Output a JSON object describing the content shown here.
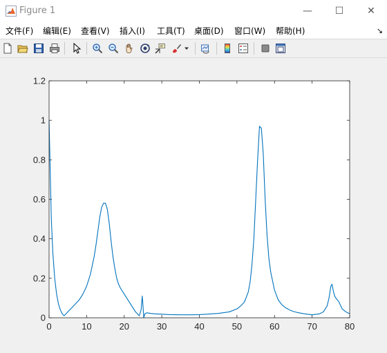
{
  "window": {
    "title": "Figure 1",
    "minimize_glyph": "—",
    "maximize_glyph": "☐",
    "close_glyph": "✕"
  },
  "menu": {
    "items": [
      "文件(F)",
      "编辑(E)",
      "查看(V)",
      "插入(I)",
      "工具(T)",
      "桌面(D)",
      "窗口(W)",
      "帮助(H)"
    ],
    "overflow_arrow": "↘"
  },
  "toolbar": {
    "icons": [
      "new-figure-icon",
      "open-file-icon",
      "save-icon",
      "print-icon",
      "select-arrow-icon",
      "zoom-in-icon",
      "zoom-out-icon",
      "pan-hand-icon",
      "rotate-3d-icon",
      "data-cursor-icon",
      "brush-icon",
      "brush-dropdown-icon",
      "link-plot-icon",
      "colorbar-icon",
      "legend-icon",
      "hide-plot-tools-icon",
      "show-plot-tools-icon"
    ]
  },
  "colors": {
    "line": "#0072bd",
    "axes_bg": "#ffffff",
    "figure_bg": "#f0f0f0"
  },
  "chart_data": {
    "type": "line",
    "xlim": [
      0,
      80
    ],
    "ylim": [
      0,
      1.2
    ],
    "xticks": [
      0,
      10,
      20,
      30,
      40,
      50,
      60,
      70,
      80
    ],
    "yticks": [
      0,
      0.2,
      0.4,
      0.6,
      0.8,
      1,
      1.2
    ],
    "xtick_labels": [
      "0",
      "10",
      "20",
      "30",
      "40",
      "50",
      "60",
      "70",
      "80"
    ],
    "ytick_labels": [
      "0",
      "0.2",
      "0.4",
      "0.6",
      "0.8",
      "1",
      "1.2"
    ],
    "grid": false,
    "series": [
      {
        "color": "#0072bd",
        "x": [
          0,
          0.3,
          0.6,
          1,
          1.5,
          2,
          2.5,
          3,
          3.5,
          4,
          5,
          6,
          7,
          8,
          9,
          10,
          11,
          12,
          12.5,
          13,
          13.5,
          14,
          14.5,
          15,
          15.5,
          16,
          16.5,
          17,
          17.5,
          18,
          18.5,
          19,
          20,
          21,
          22,
          23,
          24,
          24.5,
          24.8,
          25,
          25.2,
          25.5,
          26,
          27,
          28,
          30,
          32,
          35,
          38,
          40,
          42,
          45,
          48,
          50,
          51,
          52,
          53,
          53.5,
          54,
          54.5,
          55,
          55.5,
          56,
          56.5,
          57,
          57.5,
          58,
          58.5,
          59,
          60,
          61,
          62,
          63,
          64,
          65,
          66,
          68,
          70,
          72,
          73,
          74,
          74.5,
          75,
          75.3,
          75.6,
          76,
          76.5,
          77,
          77.5,
          78,
          79,
          80
        ],
        "y": [
          1.0,
          0.75,
          0.5,
          0.33,
          0.2,
          0.12,
          0.07,
          0.04,
          0.02,
          0.01,
          0.03,
          0.05,
          0.07,
          0.09,
          0.12,
          0.16,
          0.22,
          0.31,
          0.37,
          0.44,
          0.51,
          0.56,
          0.58,
          0.58,
          0.55,
          0.48,
          0.39,
          0.31,
          0.25,
          0.2,
          0.17,
          0.15,
          0.12,
          0.09,
          0.06,
          0.03,
          0.01,
          0.04,
          0.11,
          0.06,
          0.0,
          0.02,
          0.025,
          0.022,
          0.02,
          0.018,
          0.016,
          0.015,
          0.015,
          0.016,
          0.018,
          0.022,
          0.03,
          0.045,
          0.06,
          0.08,
          0.13,
          0.18,
          0.27,
          0.4,
          0.6,
          0.8,
          0.97,
          0.96,
          0.83,
          0.6,
          0.42,
          0.3,
          0.23,
          0.14,
          0.09,
          0.065,
          0.05,
          0.04,
          0.032,
          0.027,
          0.02,
          0.015,
          0.02,
          0.03,
          0.06,
          0.1,
          0.16,
          0.17,
          0.14,
          0.11,
          0.095,
          0.085,
          0.065,
          0.045,
          0.03,
          0.02
        ]
      }
    ]
  }
}
